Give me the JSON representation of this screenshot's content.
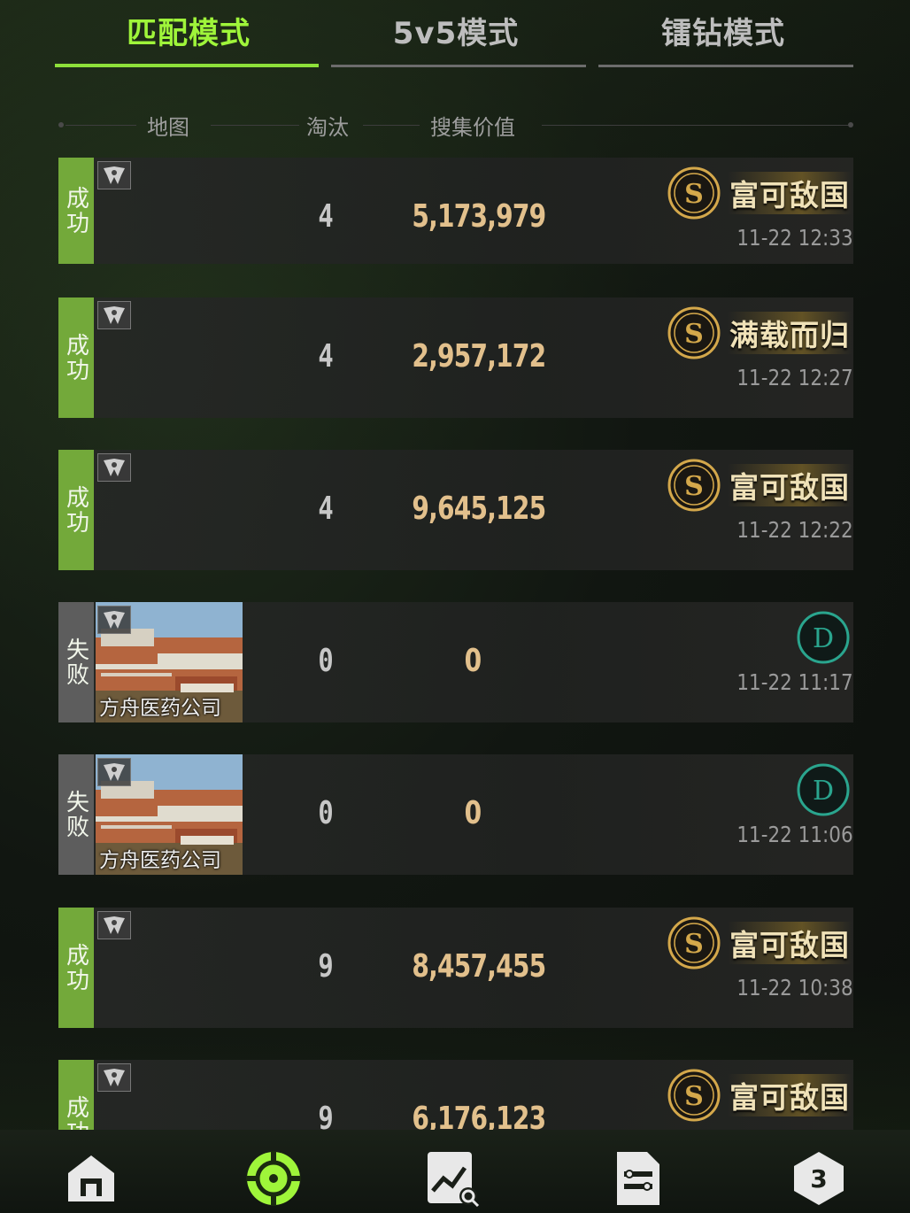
{
  "tabs": [
    {
      "label": "匹配模式",
      "active": true
    },
    {
      "label": "5v5模式",
      "active": false
    },
    {
      "label": "镭钻模式",
      "active": false
    }
  ],
  "header": {
    "map": "地图",
    "kills": "淘汰",
    "value": "搜集价值"
  },
  "rows": [
    {
      "status": "成功",
      "result": "win",
      "map_name": "",
      "kills": "4",
      "value": "5,173,979",
      "grade": "S",
      "grade_text": "富可敌国",
      "time": "11-22 12:33"
    },
    {
      "status": "成功",
      "result": "win",
      "map_name": "",
      "kills": "4",
      "value": "2,957,172",
      "grade": "S",
      "grade_text": "满载而归",
      "time": "11-22 12:27"
    },
    {
      "status": "成功",
      "result": "win",
      "map_name": "",
      "kills": "4",
      "value": "9,645,125",
      "grade": "S",
      "grade_text": "富可敌国",
      "time": "11-22 12:22"
    },
    {
      "status": "失败",
      "result": "lose",
      "map_name": "方舟医药公司",
      "kills": "0",
      "value": "0",
      "grade": "D",
      "grade_text": "",
      "time": "11-22 11:17"
    },
    {
      "status": "失败",
      "result": "lose",
      "map_name": "方舟医药公司",
      "kills": "0",
      "value": "0",
      "grade": "D",
      "grade_text": "",
      "time": "11-22 11:06"
    },
    {
      "status": "成功",
      "result": "win",
      "map_name": "",
      "kills": "9",
      "value": "8,457,455",
      "grade": "S",
      "grade_text": "富可敌国",
      "time": "11-22 10:38"
    },
    {
      "status": "成功",
      "result": "win",
      "map_name": "",
      "kills": "9",
      "value": "6,176,123",
      "grade": "S",
      "grade_text": "富可敌国",
      "time": ""
    }
  ],
  "nav": [
    {
      "icon": "home-icon",
      "active": false
    },
    {
      "icon": "crosshair-icon",
      "active": true
    },
    {
      "icon": "stats-chart-icon",
      "active": false
    },
    {
      "icon": "document-list-icon",
      "active": false
    },
    {
      "icon": "hexagon-rank-icon",
      "active": false,
      "value": "3"
    }
  ],
  "colors": {
    "accent": "#9ff53a",
    "win": "#73a93a",
    "lose": "#5d5d5d",
    "value": "#e2c08c",
    "grade_s": "#d4a84b",
    "grade_d": "#2aa58e"
  }
}
